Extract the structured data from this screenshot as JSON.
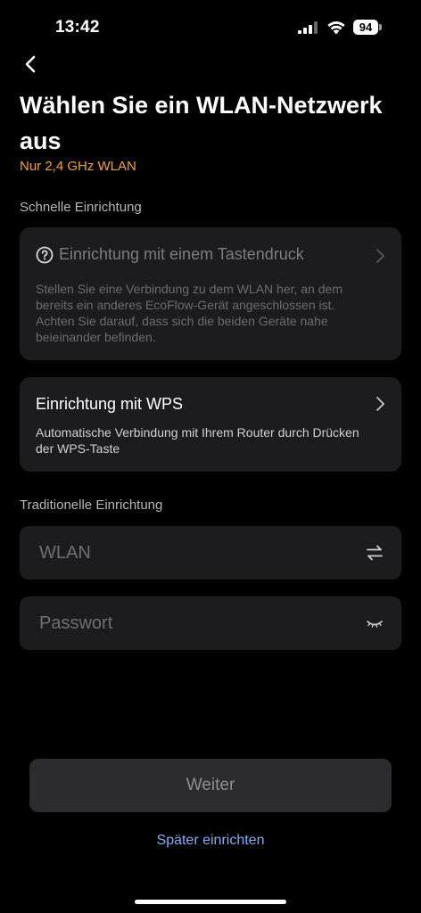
{
  "status_bar": {
    "time": "13:42",
    "battery": "94"
  },
  "header": {
    "title": "Wählen Sie ein WLAN-Netzwerk aus",
    "subtitle": "Nur 2,4 GHz WLAN"
  },
  "quick_setup": {
    "label": "Schnelle Einrichtung",
    "options": [
      {
        "title": "Einrichtung mit einem Tastendruck",
        "description": "Stellen Sie eine Verbindung zu dem WLAN her, an dem bereits ein anderes EcoFlow-Gerät angeschlossen ist. Achten Sie darauf, dass sich die beiden Geräte nahe beieinander befinden."
      },
      {
        "title": "Einrichtung mit WPS",
        "description": "Automatische Verbindung mit Ihrem Router durch Drücken der WPS-Taste"
      }
    ]
  },
  "traditional_setup": {
    "label": "Traditionelle Einrichtung",
    "wifi_placeholder": "WLAN",
    "password_placeholder": "Passwort"
  },
  "actions": {
    "continue_label": "Weiter",
    "later_label": "Später einrichten"
  },
  "colors": {
    "accent_orange": "#f5a623",
    "link_blue": "#7fb0f5",
    "card_bg": "#1c1c1e"
  },
  "icons": {
    "back": "chevron-left-icon",
    "help": "question-circle-icon",
    "switch": "swap-arrows-icon",
    "password_visibility": "eye-closed-icon"
  }
}
